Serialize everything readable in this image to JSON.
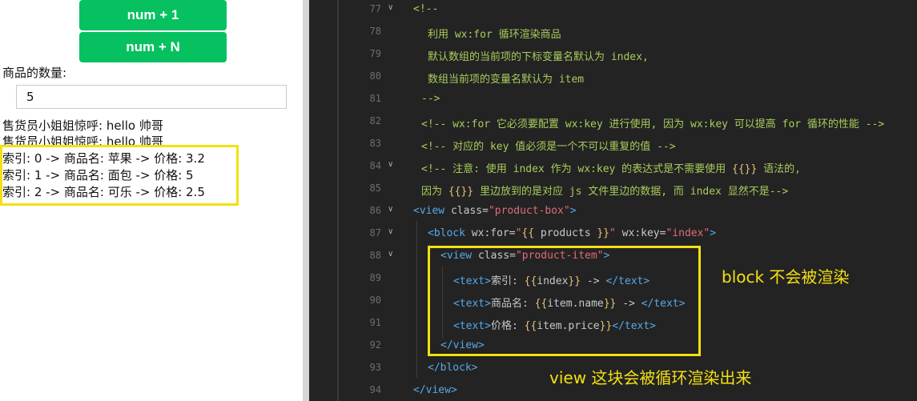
{
  "buttons": {
    "num_plus_1": "num + 1",
    "num_plus_n": "num + N"
  },
  "quantity": {
    "label": "商品的数量:",
    "value": "5"
  },
  "greetings": [
    "售货员小姐姐惊呼:  hello 帅哥",
    "售货员小姐姐惊呼:  hello 帅哥"
  ],
  "products": [
    "索引: 0 -> 商品名: 苹果 -> 价格: 3.2",
    "索引: 1 -> 商品名: 面包 -> 价格: 5",
    "索引: 2 -> 商品名: 可乐 -> 价格: 2.5"
  ],
  "editor": {
    "line_numbers": [
      "77",
      "78",
      "79",
      "80",
      "81",
      "82",
      "83",
      "84",
      "85",
      "86",
      "87",
      "88",
      "89",
      "90",
      "91",
      "92",
      "93",
      "94"
    ],
    "lines": {
      "l77": "<!--",
      "l78": "利用 wx:for 循环渲染商品",
      "l79": "默认数组的当前项的下标变量名默认为 index,",
      "l80": "数组当前项的变量名默认为 item",
      "l81": "-->",
      "l82": "<!-- wx:for 它必须要配置 wx:key 进行使用, 因为 wx:key 可以提高 for 循环的性能 -->",
      "l83": "<!-- 对应的 key 值必须是一个不可以重复的值 -->",
      "l84a": "<!-- 注意: 使用 index 作为 wx:key 的表达式是不需要使用 ",
      "l84b": "{{}}",
      "l84c": " 语法的,",
      "l85a": "因为 ",
      "l85b": "{{}}",
      "l85c": " 里边放到的是对应 js 文件里边的数据, 而 index 显然不是-->",
      "l86": {
        "tag_open": "<view",
        "attr": " class=",
        "val": "\"product-box\"",
        "close": ">"
      },
      "l87": {
        "tag_open": "<block",
        "attr1": " wx:for=",
        "val1a": "\"",
        "br1": "{{",
        "val1b": " products ",
        "br2": "}}",
        "val1c": "\"",
        "attr2": " wx:key=",
        "val2": "\"index\"",
        "close": ">"
      },
      "l88": {
        "tag_open": "<view",
        "attr": " class=",
        "val": "\"product-item\"",
        "close": ">"
      },
      "l89": {
        "open": "<text>",
        "pre": "索引: ",
        "br1": "{{",
        "var": "index",
        "br2": "}}",
        "post": " -> ",
        "close": "</text>"
      },
      "l90": {
        "open": "<text>",
        "pre": "商品名: ",
        "br1": "{{",
        "var": "item.name",
        "br2": "}}",
        "post": " -> ",
        "close": "</text>"
      },
      "l91": {
        "open": "<text>",
        "pre": "价格: ",
        "br1": "{{",
        "var": "item.price",
        "br2": "}}",
        "post": "",
        "close": "</text>"
      },
      "l92": "</view>",
      "l93": "</block>",
      "l94": "</view>"
    }
  },
  "annotations": {
    "block": "block 不会被渲染",
    "view": "view 这块会被循环渲染出来"
  },
  "colors": {
    "button_green": "#07c160",
    "highlight_yellow": "#f3e012",
    "editor_bg": "#232323",
    "comment_green": "#a8cc5c",
    "tag_blue": "#56a8e8",
    "string_red": "#e06c75",
    "brace_yellow": "#e5c07b"
  },
  "icons": [
    "fold-chevron-icon"
  ]
}
